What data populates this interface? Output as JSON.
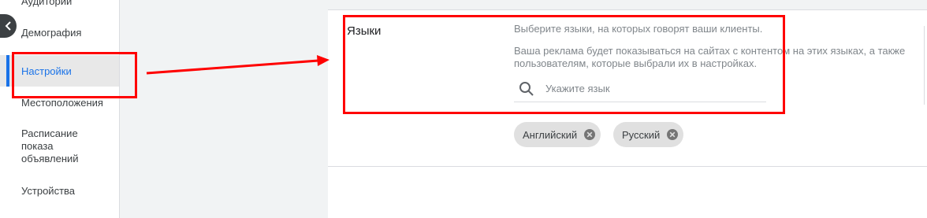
{
  "sidebar": {
    "items": [
      {
        "label": "Аудитории"
      },
      {
        "label": "Демография"
      },
      {
        "label": "Настройки"
      },
      {
        "label": "Местоположения"
      },
      {
        "label": "Расписание показа объявлений"
      },
      {
        "label": "Устройства"
      }
    ]
  },
  "languages": {
    "title": "Языки",
    "hint": "Выберите языки, на которых говорят ваши клиенты.",
    "description": "Ваша реклама будет показываться на сайтах с контентом на этих языках, а также пользователям, которые выбрали их в настройках.",
    "search_placeholder": "Укажите язык",
    "search_value": "",
    "chips": [
      {
        "label": "Английский"
      },
      {
        "label": "Русский"
      }
    ]
  },
  "colors": {
    "accent": "#1a73e8",
    "annotation": "#ff0000"
  },
  "icons": {
    "collapse": "chevron-left-icon",
    "search": "search-icon",
    "chip_remove": "close-circle-icon"
  }
}
